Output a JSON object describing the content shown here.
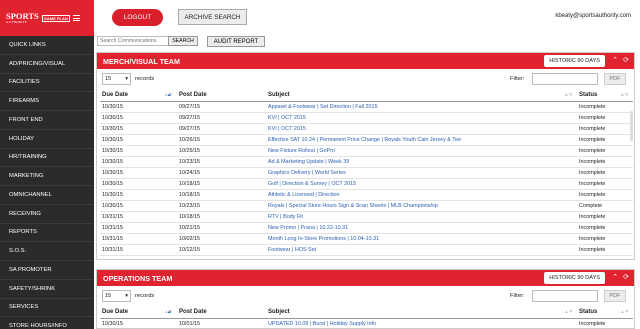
{
  "brand": {
    "logo_main": "SPORTS",
    "logo_small": "AUTHORITY",
    "logo_tag": "GAME PLAN"
  },
  "header": {
    "logout_label": "LOGOUT",
    "archive_label": "ARCHIVE SEARCH",
    "email": "kbeaty@sportsauthority.com"
  },
  "search": {
    "placeholder": "Search Communications",
    "button_label": "SEARCH",
    "audit_label": "AUDIT REPORT"
  },
  "sidebar": {
    "items": [
      {
        "label": "QUICK LINKS"
      },
      {
        "label": "AD/PRICING/VISUAL"
      },
      {
        "label": "FACILITIES"
      },
      {
        "label": "FIREARMS"
      },
      {
        "label": "FRONT END"
      },
      {
        "label": "HOLIDAY"
      },
      {
        "label": "HR/TRAINING"
      },
      {
        "label": "MARKETING"
      },
      {
        "label": "OMNICHANNEL"
      },
      {
        "label": "RECEIVING"
      },
      {
        "label": "REPORTS"
      },
      {
        "label": "S.O.S."
      },
      {
        "label": "SA PROMOTER"
      },
      {
        "label": "SAFETY/SHRINK"
      },
      {
        "label": "SERVICES"
      },
      {
        "label": "STORE HOURS/INFO"
      }
    ]
  },
  "columns": {
    "due": "Due Date",
    "post": "Post Date",
    "subject": "Subject",
    "status": "Status"
  },
  "merch": {
    "title": "MERCH/VISUAL TEAM",
    "historic_label": "HISTORIC 90 DAYS",
    "records_value": "15",
    "records_label": "records",
    "filter_label": "Filter:",
    "pdf_label": "PDF",
    "rows": [
      {
        "due": "10/30/15",
        "post": "09/27/15",
        "subject": "Apparel & Footwear | Set Direction | Fall 2015",
        "status": "Incomplete"
      },
      {
        "due": "10/30/15",
        "post": "09/27/15",
        "subject": "KVI | OCT 2015",
        "status": "Incomplete"
      },
      {
        "due": "10/30/15",
        "post": "09/27/15",
        "subject": "KVI | OCT 2015",
        "status": "Incomplete"
      },
      {
        "due": "10/30/15",
        "post": "10/26/15",
        "subject": "Effective SAT 10.24 | Permanent Price Change | Royals Youth Cain Jersey & Tee",
        "status": "Incomplete"
      },
      {
        "due": "10/30/15",
        "post": "10/25/15",
        "subject": "New Fixture Rollout | GoPro",
        "status": "Incomplete"
      },
      {
        "due": "10/30/15",
        "post": "10/23/15",
        "subject": "Ad & Marketing Update | Week 39",
        "status": "Incomplete"
      },
      {
        "due": "10/30/15",
        "post": "10/24/15",
        "subject": "Graphics Delivery | World Series",
        "status": "Incomplete"
      },
      {
        "due": "10/30/15",
        "post": "10/18/15",
        "subject": "Golf | Direction & Survey | OCT 2015",
        "status": "Incomplete"
      },
      {
        "due": "10/30/15",
        "post": "10/18/15",
        "subject": "Athletic & Licensed | Direction",
        "status": "Incomplete"
      },
      {
        "due": "10/30/15",
        "post": "10/23/15",
        "subject": "Royals | Special Store Hours Sign & Scan Sheets | MLB Championship",
        "status": "Complete"
      },
      {
        "due": "10/31/15",
        "post": "10/18/15",
        "subject": "RTV | Body Fit",
        "status": "Incomplete"
      },
      {
        "due": "10/31/15",
        "post": "10/21/15",
        "subject": "New Promo | Prana | 10.22-10.31",
        "status": "Incomplete"
      },
      {
        "due": "10/31/15",
        "post": "10/02/15",
        "subject": "Month Long In-Store Promotions | 10.04-10.31",
        "status": "Incomplete"
      },
      {
        "due": "10/31/15",
        "post": "10/12/15",
        "subject": "Footwear | HOS Set",
        "status": "Incomplete"
      }
    ]
  },
  "ops": {
    "title": "OPERATIONS TEAM",
    "historic_label": "HISTORIC 90 DAYS",
    "records_value": "15",
    "records_label": "records",
    "filter_label": "Filter:",
    "pdf_label": "PDF",
    "rows": [
      {
        "due": "10/30/15",
        "post": "10/01/15",
        "subject": "UPDATED 10.09 | Burst | Holiday Supply Info",
        "status": "Incomplete"
      }
    ]
  },
  "icons": {
    "collapse": "chevron-up-icon",
    "refresh": "refresh-icon",
    "dropdown": "chevron-down-icon"
  },
  "colors": {
    "accent": "#e0232f",
    "sidebar": "#2b2b2b",
    "link": "#2a5fb0"
  }
}
